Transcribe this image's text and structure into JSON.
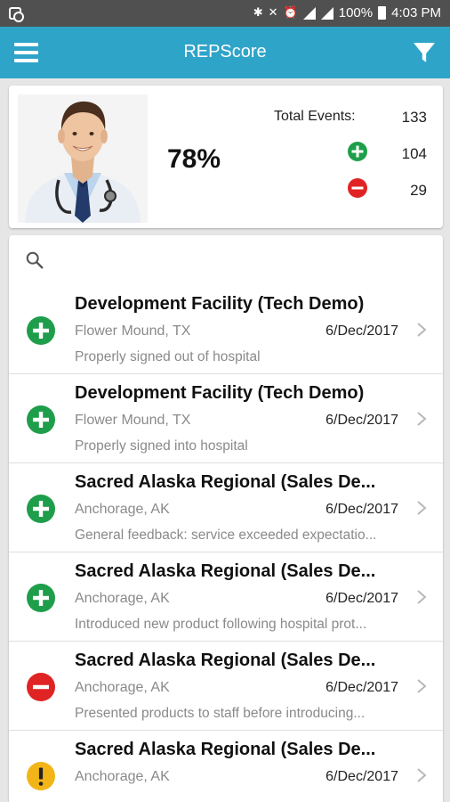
{
  "status_bar": {
    "battery": "100%",
    "time": "4:03 PM"
  },
  "app_bar": {
    "title": "REPScore"
  },
  "summary": {
    "score": "78%",
    "total_label": "Total Events:",
    "total_value": "133",
    "positive_value": "104",
    "negative_value": "29"
  },
  "colors": {
    "header": "#2fa4c9",
    "positive": "#1e9e4a",
    "negative": "#e02424",
    "warning": "#f2b517"
  },
  "events": [
    {
      "status": "positive",
      "icon": "plus-circle-icon",
      "title": "Development Facility (Tech Demo)",
      "location": "Flower Mound, TX",
      "date": "6/Dec/2017",
      "note": "Properly signed out of hospital"
    },
    {
      "status": "positive",
      "icon": "plus-circle-icon",
      "title": "Development Facility (Tech Demo)",
      "location": "Flower Mound, TX",
      "date": "6/Dec/2017",
      "note": "Properly signed into hospital"
    },
    {
      "status": "positive",
      "icon": "plus-circle-icon",
      "title": "Sacred Alaska Regional (Sales De...",
      "location": "Anchorage, AK",
      "date": "6/Dec/2017",
      "note": "General feedback: service exceeded expectatio..."
    },
    {
      "status": "positive",
      "icon": "plus-circle-icon",
      "title": "Sacred Alaska Regional (Sales De...",
      "location": "Anchorage, AK",
      "date": "6/Dec/2017",
      "note": "Introduced new product following hospital prot..."
    },
    {
      "status": "negative",
      "icon": "minus-circle-icon",
      "title": "Sacred Alaska Regional (Sales De...",
      "location": "Anchorage, AK",
      "date": "6/Dec/2017",
      "note": "Presented products to staff before introducing..."
    },
    {
      "status": "warning",
      "icon": "exclamation-circle-icon",
      "title": "Sacred Alaska Regional (Sales De...",
      "location": "Anchorage, AK",
      "date": "6/Dec/2017",
      "note": ""
    }
  ]
}
